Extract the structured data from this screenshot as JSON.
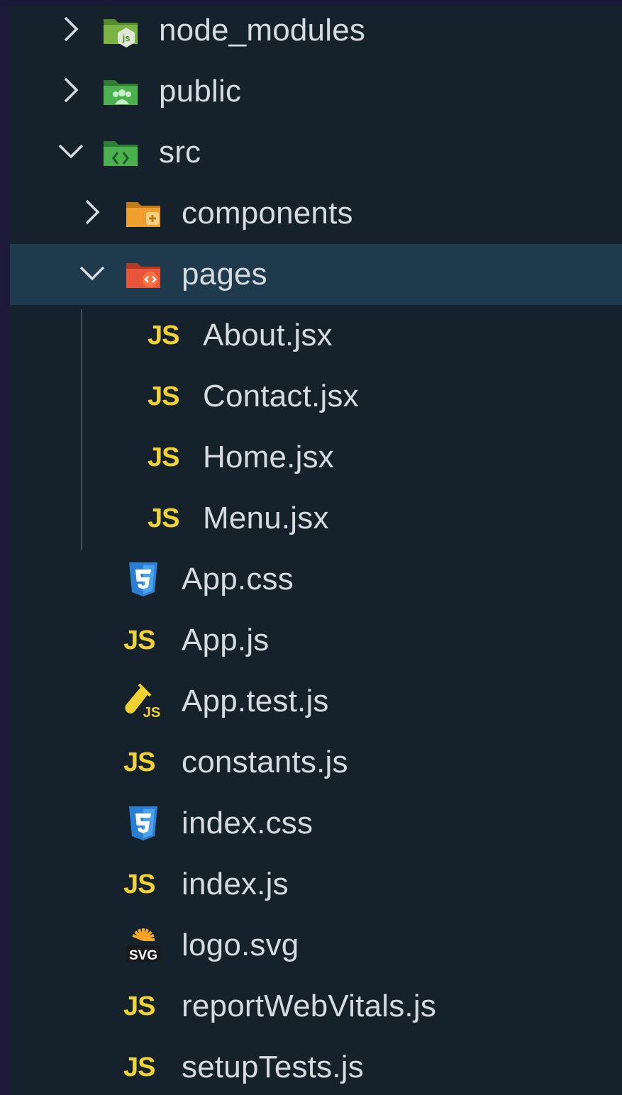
{
  "explorer": {
    "items": [
      {
        "label": "node_modules",
        "type": "folder",
        "state": "collapsed",
        "icon": "folder-node-icon",
        "depth": 0
      },
      {
        "label": "public",
        "type": "folder",
        "state": "collapsed",
        "icon": "folder-public-icon",
        "depth": 0
      },
      {
        "label": "src",
        "type": "folder",
        "state": "expanded",
        "icon": "folder-src-icon",
        "depth": 0
      },
      {
        "label": "components",
        "type": "folder",
        "state": "collapsed",
        "icon": "folder-components-icon",
        "depth": 1
      },
      {
        "label": "pages",
        "type": "folder",
        "state": "expanded",
        "icon": "folder-pages-icon",
        "depth": 1,
        "selected": true
      },
      {
        "label": "About.jsx",
        "type": "file",
        "icon": "js-file-icon",
        "icon_text": "JS",
        "depth": 2
      },
      {
        "label": "Contact.jsx",
        "type": "file",
        "icon": "js-file-icon",
        "icon_text": "JS",
        "depth": 2
      },
      {
        "label": "Home.jsx",
        "type": "file",
        "icon": "js-file-icon",
        "icon_text": "JS",
        "depth": 2
      },
      {
        "label": "Menu.jsx",
        "type": "file",
        "icon": "js-file-icon",
        "icon_text": "JS",
        "depth": 2
      },
      {
        "label": "App.css",
        "type": "file",
        "icon": "css-file-icon",
        "depth": 1
      },
      {
        "label": "App.js",
        "type": "file",
        "icon": "js-file-icon",
        "icon_text": "JS",
        "depth": 1
      },
      {
        "label": "App.test.js",
        "type": "file",
        "icon": "test-js-file-icon",
        "depth": 1
      },
      {
        "label": "constants.js",
        "type": "file",
        "icon": "js-file-icon",
        "icon_text": "JS",
        "depth": 1
      },
      {
        "label": "index.css",
        "type": "file",
        "icon": "css-file-icon",
        "depth": 1
      },
      {
        "label": "index.js",
        "type": "file",
        "icon": "js-file-icon",
        "icon_text": "JS",
        "depth": 1
      },
      {
        "label": "logo.svg",
        "type": "file",
        "icon": "svg-file-icon",
        "icon_text": "SVG",
        "depth": 1
      },
      {
        "label": "reportWebVitals.js",
        "type": "file",
        "icon": "js-file-icon",
        "icon_text": "JS",
        "depth": 1
      },
      {
        "label": "setupTests.js",
        "type": "file",
        "icon": "js-file-icon",
        "icon_text": "JS",
        "depth": 1
      }
    ],
    "colors": {
      "background": "#15222c",
      "selected_row": "#1f3a4c",
      "text": "#d6dbe2",
      "js_yellow": "#f0d232",
      "css_blue": "#2a7fd4",
      "folder_green": "#4caf50",
      "folder_orange": "#f0a030",
      "folder_red": "#e8553a"
    }
  }
}
